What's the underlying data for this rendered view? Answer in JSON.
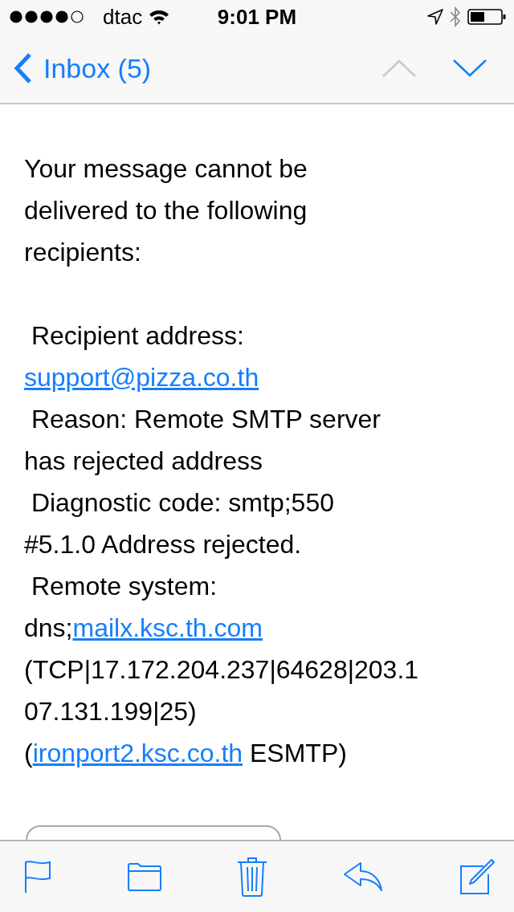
{
  "status_bar": {
    "carrier": "dtac",
    "time": "9:01 PM"
  },
  "nav": {
    "back_label": "Inbox (5)",
    "previous_disabled": true,
    "next_disabled": false
  },
  "message": {
    "paragraphs": [
      [
        [
          {
            "kind": "text",
            "text": "Your message cannot be"
          }
        ],
        [
          {
            "kind": "text",
            "text": "delivered to the following"
          }
        ],
        [
          {
            "kind": "text",
            "text": "recipients:"
          }
        ]
      ],
      [
        [
          {
            "kind": "text",
            "text": " Recipient address:"
          }
        ],
        [
          {
            "kind": "link",
            "text": "support@pizza.co.th"
          }
        ],
        [
          {
            "kind": "text",
            "text": " Reason: Remote SMTP server"
          }
        ],
        [
          {
            "kind": "text",
            "text": "has rejected address"
          }
        ],
        [
          {
            "kind": "text",
            "text": " Diagnostic code: smtp;550"
          }
        ],
        [
          {
            "kind": "text",
            "text": "#5.1.0 Address rejected."
          }
        ],
        [
          {
            "kind": "text",
            "text": " Remote system:"
          }
        ],
        [
          {
            "kind": "text",
            "text": "dns;"
          },
          {
            "kind": "link",
            "text": "mailx.ksc.th.com"
          }
        ],
        [
          {
            "kind": "text",
            "text": "(TCP|17.172.204.237|64628|203.1"
          }
        ],
        [
          {
            "kind": "text",
            "text": "07.131.199|25)"
          }
        ],
        [
          {
            "kind": "text",
            "text": "("
          },
          {
            "kind": "link",
            "text": "ironport2.ksc.co.th"
          },
          {
            "kind": "text",
            "text": " ESMTP)"
          }
        ]
      ]
    ]
  }
}
